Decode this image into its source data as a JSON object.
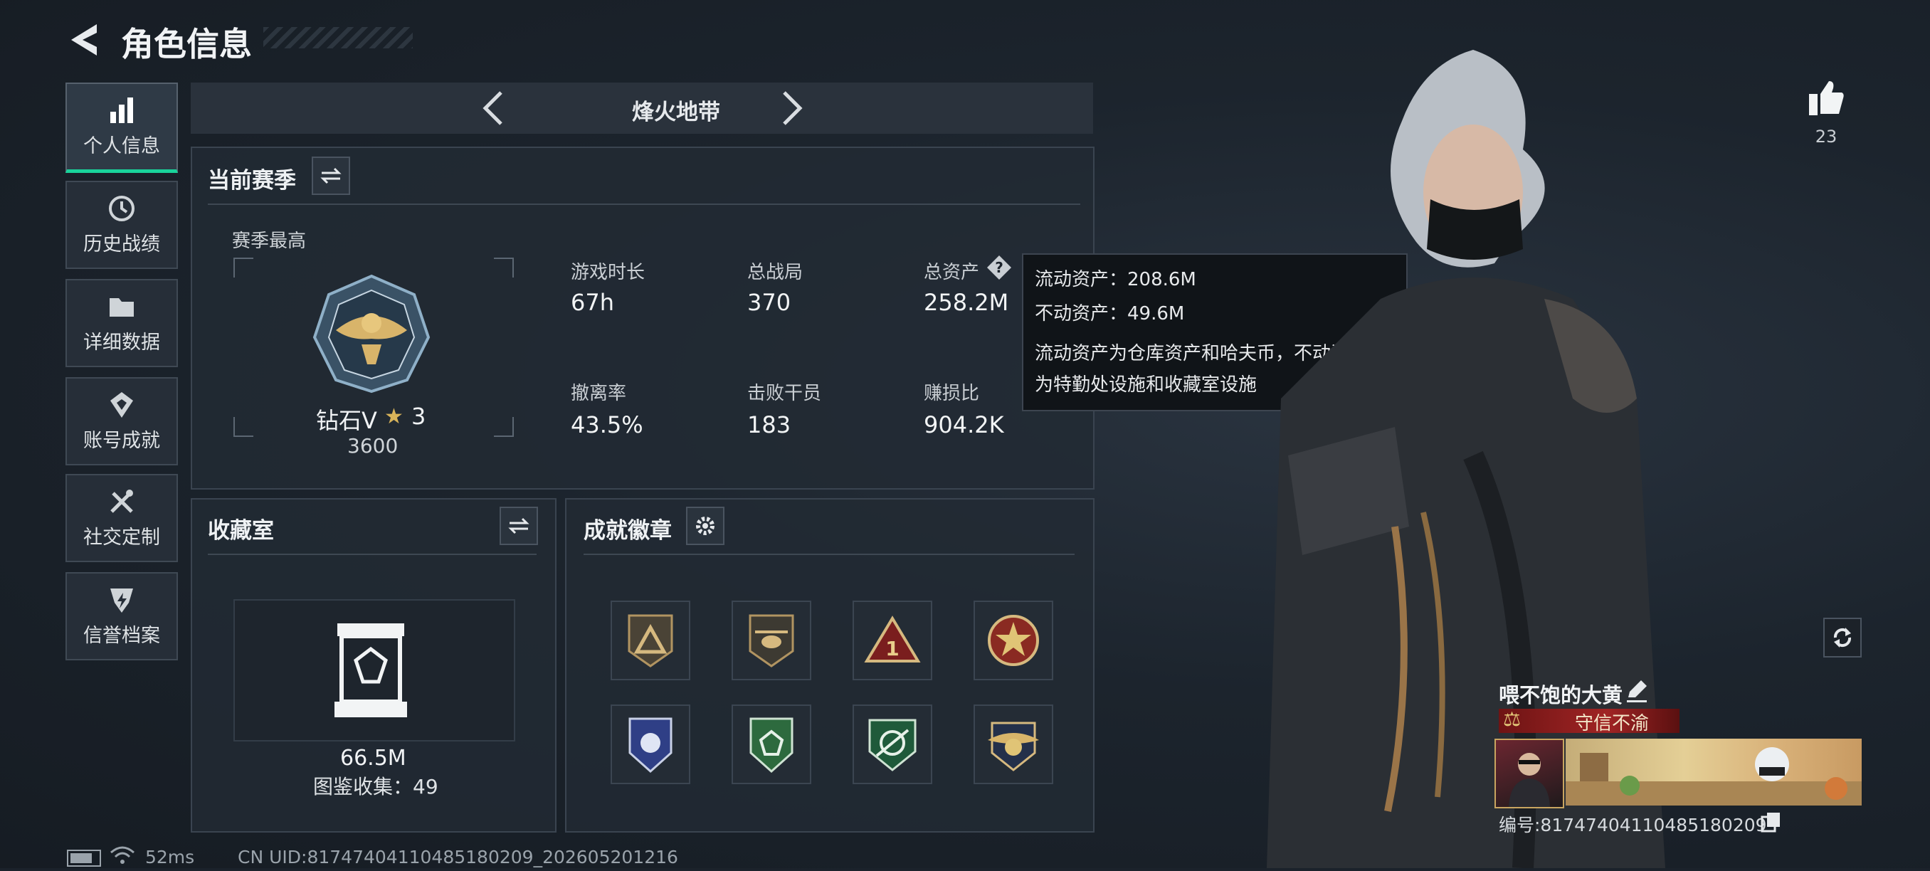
{
  "header": {
    "title": "角色信息"
  },
  "sidebar": {
    "items": [
      {
        "label": "个人信息",
        "icon": "bar-chart-icon",
        "active": true
      },
      {
        "label": "历史战绩",
        "icon": "history-icon"
      },
      {
        "label": "详细数据",
        "icon": "folder-icon"
      },
      {
        "label": "账号成就",
        "icon": "achievement-icon"
      },
      {
        "label": "社交定制",
        "icon": "tools-icon"
      },
      {
        "label": "信誉档案",
        "icon": "shield-icon"
      }
    ]
  },
  "mode_selector": {
    "label": "烽火地带"
  },
  "season": {
    "title": "当前赛季",
    "highest_label": "赛季最高",
    "rank_name": "钻石V",
    "rank_stars": "3",
    "rank_points": "3600",
    "stats": [
      {
        "label": "游戏时长",
        "value": "67h"
      },
      {
        "label": "总战局",
        "value": "370"
      },
      {
        "label": "总资产",
        "value": "258.2M"
      },
      {
        "label": "撤离率",
        "value": "43.5%"
      },
      {
        "label": "击败干员",
        "value": "183"
      },
      {
        "label": "赚损比",
        "value": "904.2K"
      }
    ]
  },
  "tooltip": {
    "line1": "流动资产：208.6M",
    "line2": "不动资产：49.6M",
    "line3": "流动资产为仓库资产和哈夫币，不动资产",
    "line4": "为特勤处设施和收藏室设施"
  },
  "collection": {
    "title": "收藏室",
    "value": "66.5M",
    "codex": "图鉴收集：49"
  },
  "achievements": {
    "title": "成就徽章",
    "badges": [
      "triangle-badge",
      "helicopter-badge",
      "number-one-badge",
      "star-medal-badge",
      "blue-shield-badge",
      "green-shield-badge",
      "rifle-badge",
      "gold-wings-badge"
    ]
  },
  "likes": {
    "count": "23"
  },
  "player": {
    "name": "喂不饱的大黄",
    "title": "守信不渝",
    "id": "编号:81747404110485180209"
  },
  "footer": {
    "ping": "52ms",
    "uid": "CN UID:81747404110485180209_202605201216"
  },
  "colors": {
    "accent": "#19d39a",
    "panel": "#222a34",
    "title_red": "#8a1c1c"
  }
}
